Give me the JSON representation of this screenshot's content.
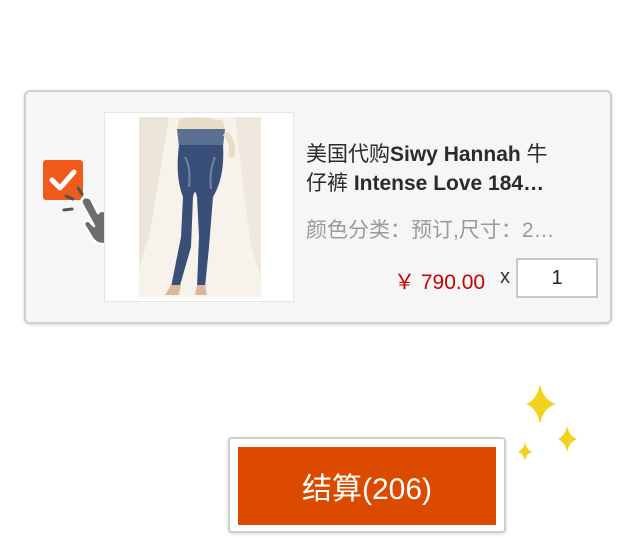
{
  "cart_item": {
    "selected": true,
    "title_cn_1": "美国代购",
    "title_en_1": "Siwy Hannah",
    "title_cn_2": " 牛",
    "title_cn_3": "仔裤",
    "title_en_2": " Intense Love 184…",
    "spec": "颜色分类：预订,尺寸：2…",
    "price": "￥ 790.00",
    "times": "x",
    "quantity": "1"
  },
  "checkout": {
    "label": "结算(206)"
  },
  "colors": {
    "accent": "#f05a1a",
    "button": "#dc4a00",
    "price": "#c80000",
    "sparkle": "#f2d21b"
  },
  "icons": [
    "checkmark-icon",
    "tap-hand-icon",
    "sparkle-icon"
  ]
}
